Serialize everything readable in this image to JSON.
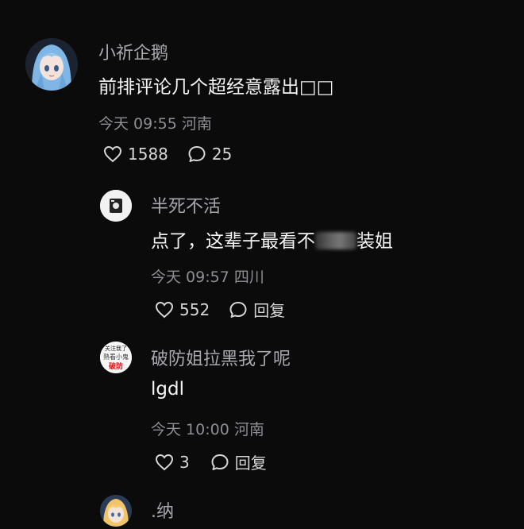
{
  "comments": [
    {
      "user": "小祈企鹅",
      "text": "前排评论几个超经意露出□□",
      "meta": "今天 09:55 河南",
      "likes": "1588",
      "replies": "25"
    },
    {
      "user": "半死不活",
      "text_before": "点了，这辈子最看不",
      "text_after": "装姐",
      "meta": "今天 09:57 四川",
      "likes": "552",
      "reply_label": "回复"
    },
    {
      "user": "破防姐拉黑我了呢",
      "text": "lgdl",
      "meta": "今天 10:00 河南",
      "likes": "3",
      "reply_label": "回复",
      "avatar_text": [
        "关注我了",
        "熟看小鬼",
        "破防"
      ]
    },
    {
      "user": ".纳"
    }
  ],
  "colors": {
    "background": "#0b0b0b",
    "username": "#a8a8ae",
    "text": "#f4f4f4",
    "meta": "#8e8e94"
  }
}
